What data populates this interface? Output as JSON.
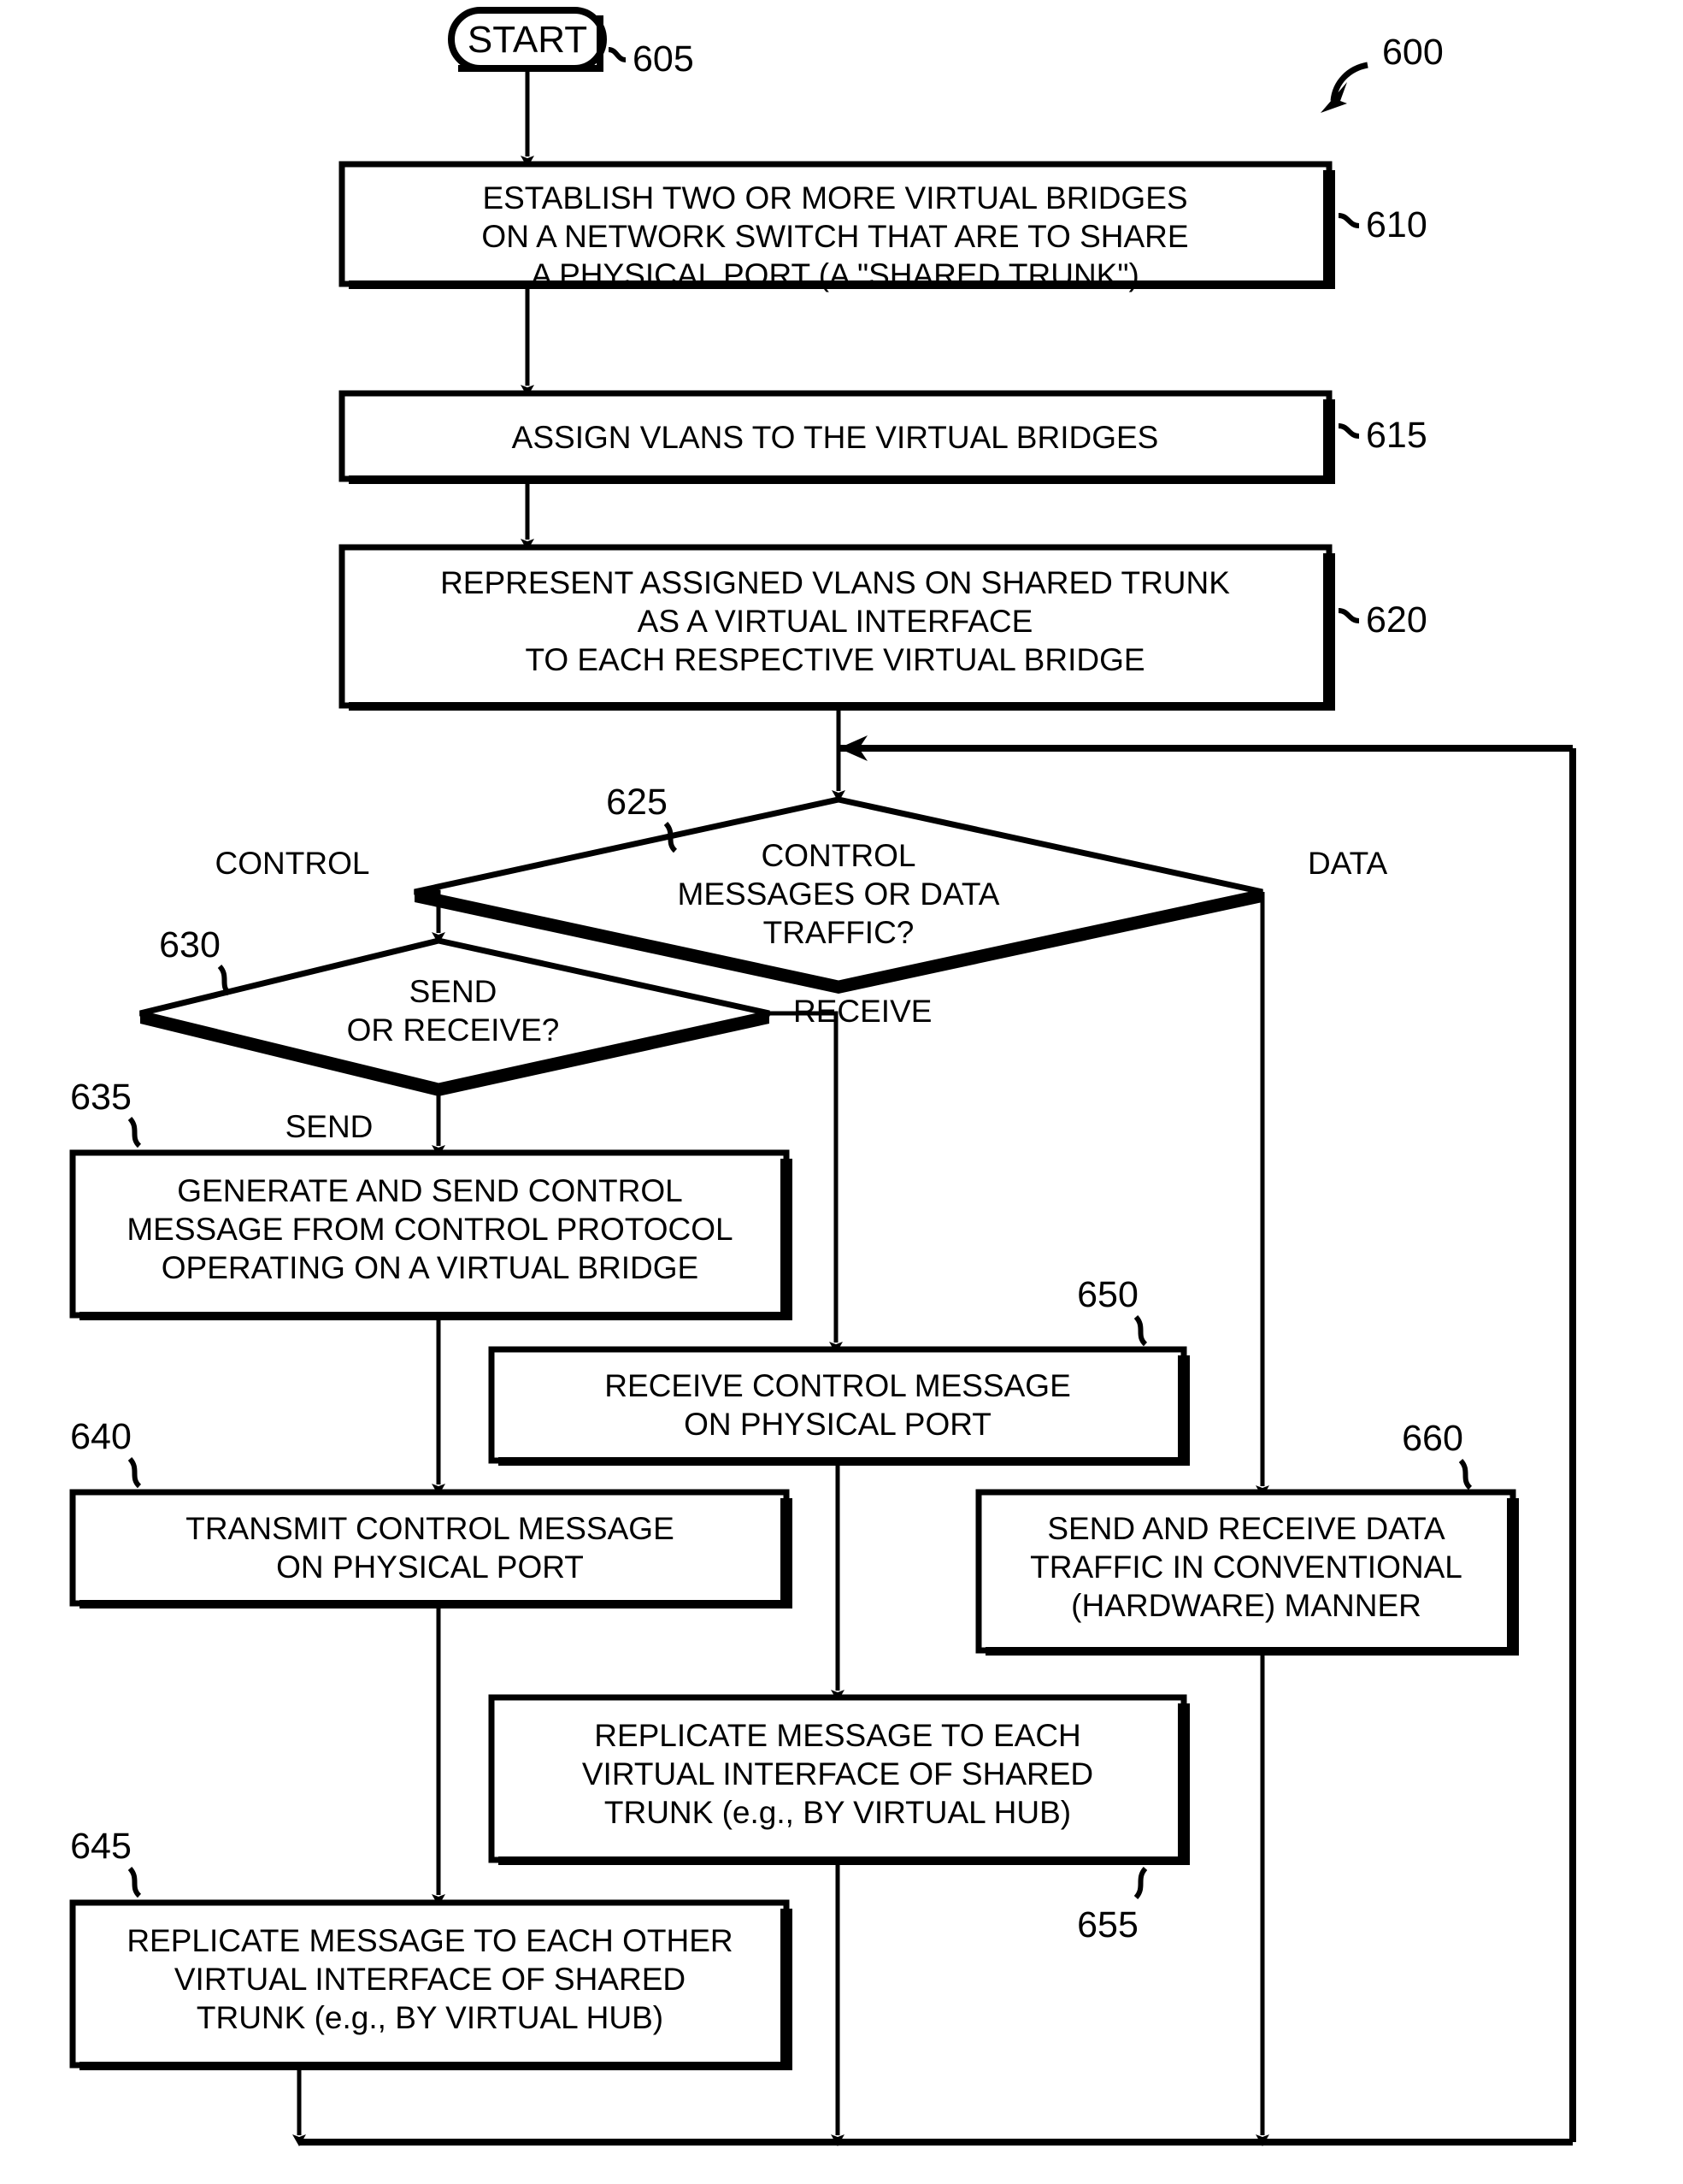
{
  "figure": {
    "number": "600",
    "type": "patent-flowchart"
  },
  "nodes": {
    "start": {
      "ref": "605",
      "label": "START",
      "shape": "terminator"
    },
    "step610": {
      "ref": "610",
      "shape": "process",
      "lines": [
        "ESTABLISH TWO OR MORE VIRTUAL BRIDGES",
        "ON A NETWORK SWITCH THAT ARE TO SHARE",
        "A PHYSICAL PORT (A \"SHARED TRUNK\")"
      ]
    },
    "step615": {
      "ref": "615",
      "shape": "process",
      "lines": [
        "ASSIGN VLANS TO THE VIRTUAL BRIDGES"
      ]
    },
    "step620": {
      "ref": "620",
      "shape": "process",
      "lines": [
        "REPRESENT ASSIGNED VLANS ON SHARED TRUNK",
        "AS A VIRTUAL INTERFACE",
        "TO EACH RESPECTIVE VIRTUAL BRIDGE"
      ]
    },
    "decision625": {
      "ref": "625",
      "shape": "decision",
      "lines": [
        "CONTROL",
        "MESSAGES OR DATA",
        "TRAFFIC?"
      ]
    },
    "decision630": {
      "ref": "630",
      "shape": "decision",
      "lines": [
        "SEND",
        "OR RECEIVE?"
      ]
    },
    "step635": {
      "ref": "635",
      "shape": "process",
      "lines": [
        "GENERATE AND SEND CONTROL",
        "MESSAGE FROM CONTROL PROTOCOL",
        "OPERATING ON A VIRTUAL BRIDGE"
      ]
    },
    "step640": {
      "ref": "640",
      "shape": "process",
      "lines": [
        "TRANSMIT CONTROL MESSAGE",
        "ON PHYSICAL PORT"
      ]
    },
    "step645": {
      "ref": "645",
      "shape": "process",
      "lines": [
        "REPLICATE MESSAGE TO EACH OTHER",
        "VIRTUAL INTERFACE OF SHARED",
        "TRUNK (e.g., BY VIRTUAL HUB)"
      ]
    },
    "step650": {
      "ref": "650",
      "shape": "process",
      "lines": [
        "RECEIVE CONTROL MESSAGE",
        "ON PHYSICAL PORT"
      ]
    },
    "step655": {
      "ref": "655",
      "shape": "process",
      "lines": [
        "REPLICATE MESSAGE TO EACH",
        "VIRTUAL INTERFACE OF SHARED",
        "TRUNK (e.g., BY VIRTUAL HUB)"
      ]
    },
    "step660": {
      "ref": "660",
      "shape": "process",
      "lines": [
        "SEND AND RECEIVE DATA",
        "TRAFFIC IN CONVENTIONAL",
        "(HARDWARE) MANNER"
      ]
    }
  },
  "branch_labels": {
    "control": "CONTROL",
    "data": "DATA",
    "send": "SEND",
    "receive": "RECEIVE"
  },
  "colors": {
    "ink": "#000000",
    "paper": "#ffffff"
  }
}
